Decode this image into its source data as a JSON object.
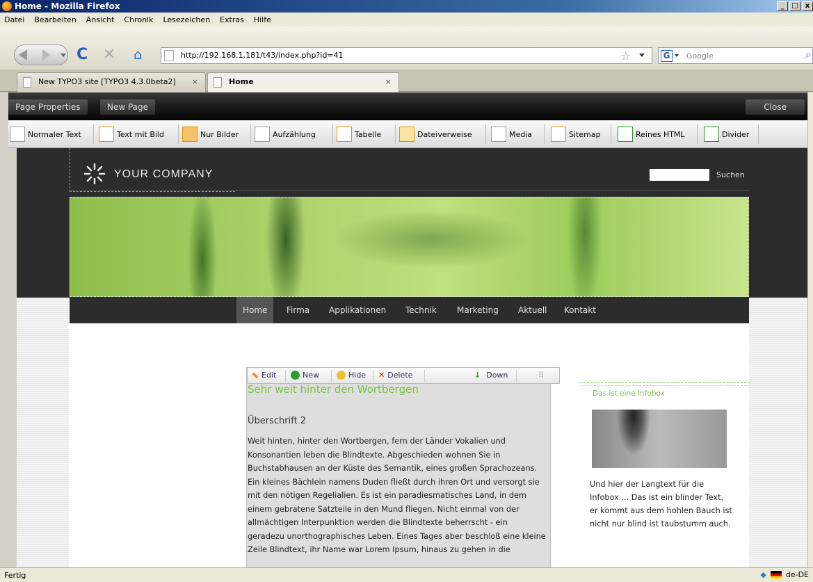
{
  "window": {
    "title": "Home - Mozilla Firefox",
    "min": "_",
    "max": "□",
    "close": "x"
  },
  "menu": [
    "Datei",
    "Bearbeiten",
    "Ansicht",
    "Chronik",
    "Lesezeichen",
    "Extras",
    "Hilfe"
  ],
  "nav": {
    "url": "http://192.168.1.181/t43/index.php?id=41",
    "search_placeholder": "Google"
  },
  "tabs": [
    {
      "label": "New TYPO3 site [TYPO3 4.3.0beta2]"
    },
    {
      "label": "Home"
    }
  ],
  "typo3": {
    "page_properties": "Page Properties",
    "new_page": "New Page",
    "close": "Close",
    "content_elements": [
      "Normaler Text",
      "Text mit Bild",
      "Nur Bilder",
      "Aufzählung",
      "Tabelle",
      "Dateiverweise",
      "Media",
      "Sitemap",
      "Reines HTML",
      "Divider"
    ]
  },
  "site": {
    "company": "YOUR COMPANY",
    "search_button": "Suchen",
    "nav_items": [
      "Home",
      "Firma",
      "Applikationen",
      "Technik",
      "Marketing",
      "Aktuell",
      "Kontakt"
    ],
    "active_nav": "Home"
  },
  "ce_panel": {
    "edit": "Edit",
    "new": "New",
    "hide": "Hide",
    "delete": "Delete",
    "down": "Down"
  },
  "content": {
    "heading": "Sehr weit hinter den Wortbergen",
    "subheading": "Überschrift 2",
    "body": "Weit hinten, hinter den Wortbergen, fern der Länder Vokalien und Konsonantien leben die Blindtexte. Abgeschieden wohnen Sie in Buchstabhausen an der Küste des Semantik, eines großen Sprachozeans. Ein kleines Bächlein namens Duden fließt durch ihren Ort und versorgt sie mit den nötigen Regelialien. Es ist ein paradiesmatisches Land, in dem einem gebratene Satzteile in den Mund fliegen. Nicht einmal von der allmächtigen Interpunktion werden die Blindtexte beherrscht - ein geradezu unorthographisches Leben. Eines Tages aber beschloß eine kleine Zeile Blindtext, ihr Name war Lorem Ipsum, hinaus zu gehen in die"
  },
  "infobox": {
    "title": "Das ist eine Infobox",
    "text": "Und hier der Langtext für die Infobox ... Das ist ein blinder Text, er kommt aus dem hohlen Bauch ist nicht nur blind ist taubstumm auch."
  },
  "status": {
    "text": "Fertig",
    "lang": "de-DE"
  }
}
